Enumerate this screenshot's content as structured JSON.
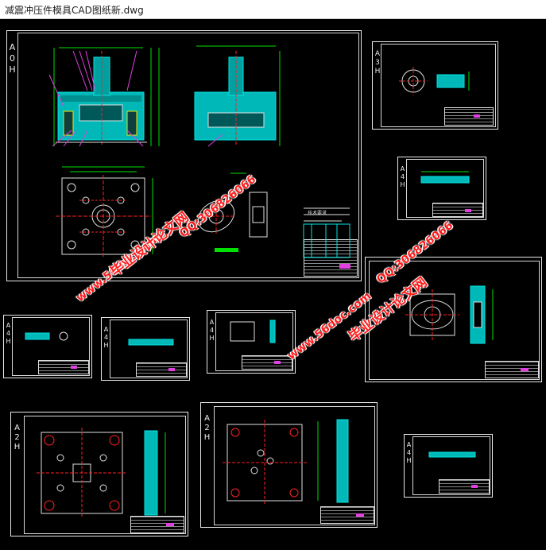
{
  "window": {
    "title": "减震冲压件模具CAD图纸新.dwg"
  },
  "sheets": {
    "main": {
      "label": "A0H"
    },
    "s2": {
      "label": "A3H"
    },
    "s3": {
      "label": "A4H"
    },
    "s4": {
      "label": "A4H"
    },
    "s5": {
      "label": "A4H"
    },
    "s6": {
      "label": "A4H"
    },
    "s7": {
      "label": "A4H"
    },
    "s8": {
      "label": "A2H"
    },
    "s9": {
      "label": "A2H"
    },
    "s10": {
      "label": "A4H"
    }
  },
  "notes": {
    "title": "技术要求"
  },
  "watermarks": {
    "site": "www.56doc.com",
    "name": "毕业设计论文网",
    "qq": "QQ:306826066"
  },
  "colors": {
    "background": "#000000",
    "cyan": "#00e5e5",
    "green": "#00e000",
    "yellow": "#e8e800",
    "magenta": "#e040e0",
    "red": "#ff2020",
    "watermark": "#ff1a1a"
  }
}
